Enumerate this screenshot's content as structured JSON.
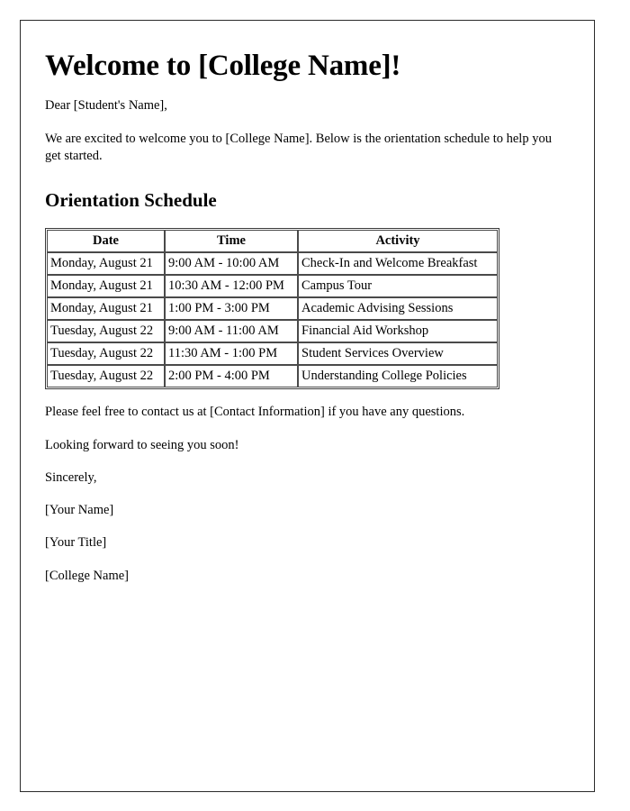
{
  "document": {
    "title": "Welcome to [College Name]!",
    "salutation": "Dear [Student's Name],",
    "intro_paragraph": "We are excited to welcome you to [College Name]. Below is the orientation schedule to help you get started.",
    "section_heading": "Orientation Schedule",
    "contact_paragraph": "Please feel free to contact us at [Contact Information] if you have any questions.",
    "closing_paragraph": "Looking forward to seeing you soon!",
    "sign_off": "Sincerely,",
    "signature": {
      "name": "[Your Name]",
      "title": "[Your Title]",
      "organization": "[College Name]"
    }
  },
  "schedule_table": {
    "columns": [
      "Date",
      "Time",
      "Activity"
    ],
    "rows": [
      {
        "date": "Monday, August 21",
        "time": "9:00 AM - 10:00 AM",
        "activity": "Check-In and Welcome Breakfast"
      },
      {
        "date": "Monday, August 21",
        "time": "10:30 AM - 12:00 PM",
        "activity": "Campus Tour"
      },
      {
        "date": "Monday, August 21",
        "time": "1:00 PM - 3:00 PM",
        "activity": "Academic Advising Sessions"
      },
      {
        "date": "Tuesday, August 22",
        "time": "9:00 AM - 11:00 AM",
        "activity": "Financial Aid Workshop"
      },
      {
        "date": "Tuesday, August 22",
        "time": "11:30 AM - 1:00 PM",
        "activity": "Student Services Overview"
      },
      {
        "date": "Tuesday, August 22",
        "time": "2:00 PM - 4:00 PM",
        "activity": "Understanding College Policies"
      }
    ]
  },
  "colors": {
    "page_background": "#ffffff",
    "text": "#000000",
    "page_border": "#2b2b2b",
    "table_border": "#4a4a4a"
  }
}
